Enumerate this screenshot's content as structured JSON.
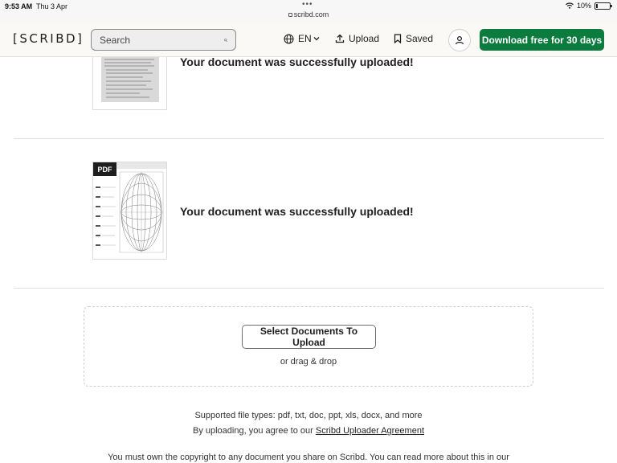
{
  "status_bar": {
    "time": "9:53 AM",
    "date": "Thu 3 Apr",
    "url": "scribd.com",
    "battery": "10%",
    "battery_level": 0.1
  },
  "header": {
    "logo": "[SCRIBD]",
    "search_placeholder": "Search",
    "language": "EN",
    "upload_label": "Upload",
    "saved_label": "Saved",
    "cta_label": "Download free for 30 days",
    "cta_color": "#0b7b3e"
  },
  "uploads": [
    {
      "message": "Your document was successfully uploaded!"
    },
    {
      "message": "Your document was successfully uploaded!",
      "badge": "PDF"
    }
  ],
  "uploader": {
    "select_button": "Select Documents To Upload",
    "drag_text": "or drag & drop",
    "supported_types": "Supported file types: pdf, txt, doc, ppt, xls, docx, and more",
    "agreement_prefix": "By uploading, you agree to our",
    "agreement_link": "Scribd Uploader Agreement",
    "copyright_notice": "You must own the copyright to any document you share on Scribd. You can read more about this in our"
  },
  "icons": [
    "lock-icon",
    "wifi-icon",
    "battery-icon",
    "search-icon",
    "globe-icon",
    "chevron-down-icon",
    "upload-icon",
    "bookmark-icon",
    "user-icon"
  ]
}
